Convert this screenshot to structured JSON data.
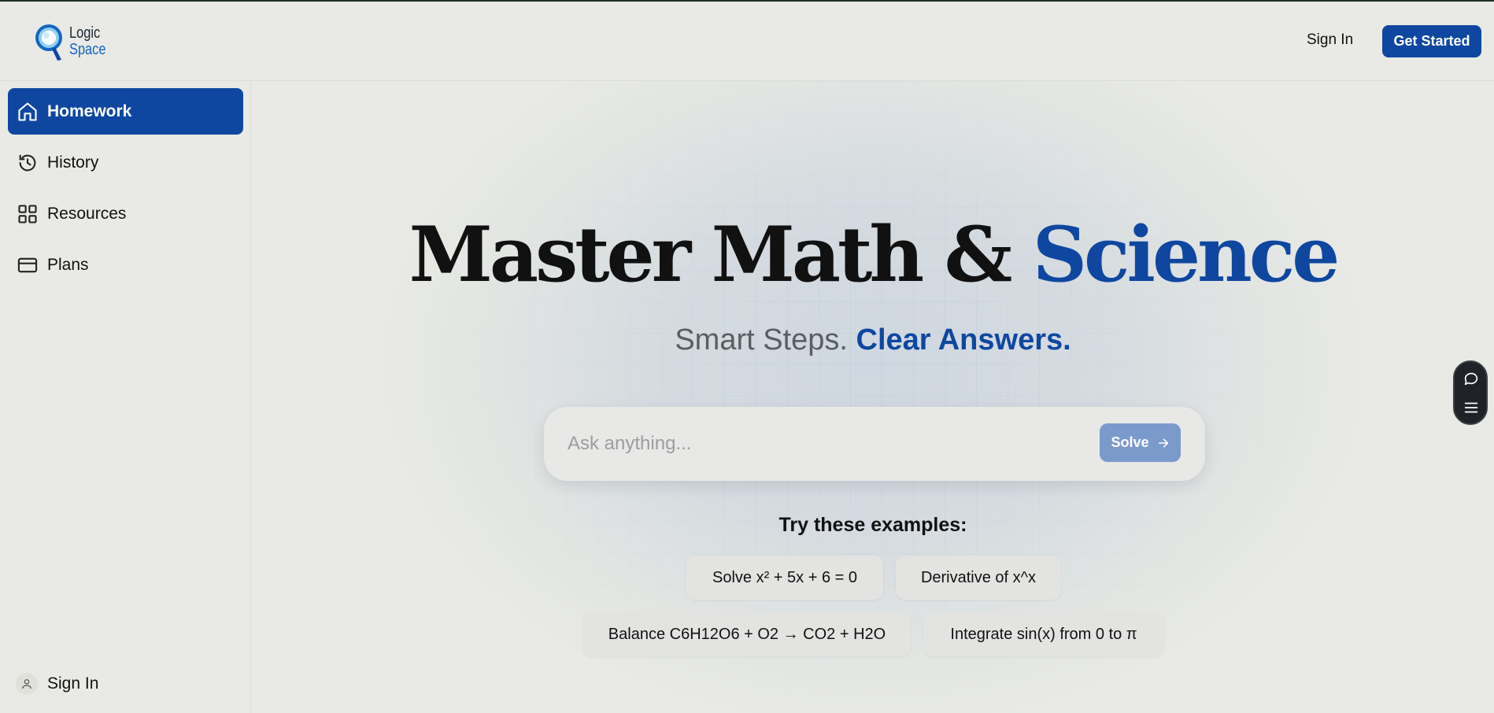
{
  "brand": {
    "line1": "Logic",
    "line2": "Space"
  },
  "header": {
    "sign_in": "Sign In",
    "cta": "Get Started"
  },
  "sidebar": {
    "items": [
      {
        "label": "Homework",
        "icon": "home-icon",
        "active": true
      },
      {
        "label": "History",
        "icon": "history-icon"
      },
      {
        "label": "Resources",
        "icon": "grid-icon"
      },
      {
        "label": "Plans",
        "icon": "credit-card-icon"
      }
    ],
    "sign_in": "Sign In"
  },
  "hero": {
    "title_main": "Master Math & ",
    "title_accent": "Science",
    "subtitle_main": "Smart Steps. ",
    "subtitle_accent": "Clear Answers."
  },
  "search": {
    "placeholder": "Ask anything...",
    "value": "",
    "button": "Solve"
  },
  "examples": {
    "title": "Try these examples:",
    "items": [
      "Solve x² + 5x + 6 = 0",
      "Derivative of x^x",
      "Balance C6H12O6 + O2 → CO2 + H2O",
      "Integrate sin(x) from 0 to π"
    ]
  },
  "colors": {
    "accent": "#0f47a0",
    "background": "#e9eae5",
    "solve_button": "#7b9acc"
  }
}
